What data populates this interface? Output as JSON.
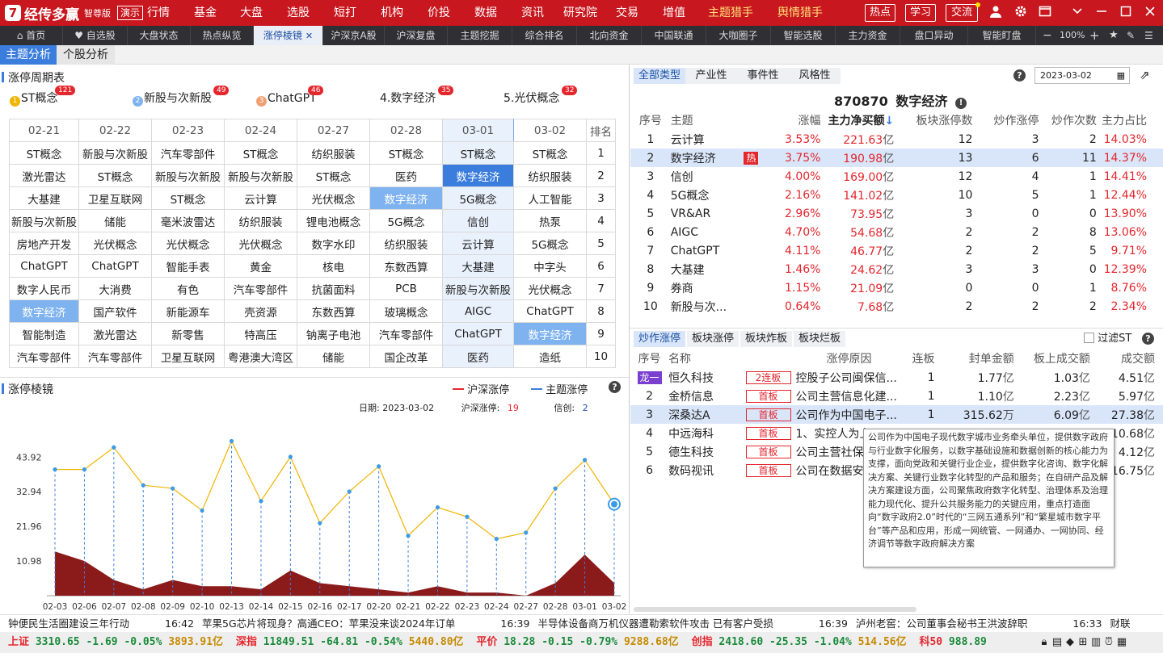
{
  "app": {
    "logo_letter": "7",
    "name": "经传多赢",
    "edition": "智尊版",
    "demo": "演示",
    "nav": [
      "行情",
      "基金",
      "大盘",
      "选股",
      "短打",
      "机构",
      "价投",
      "数据",
      "资讯",
      "研究院",
      "交易",
      "增值",
      "主题猎手",
      "舆情猎手"
    ],
    "boxes": [
      "热点",
      "学习",
      "交流"
    ]
  },
  "tabs": [
    "首页",
    "自选股",
    "大盘状态",
    "热点纵览",
    "涨停棱镜",
    "沪深京A股",
    "沪深复盘",
    "主题挖掘",
    "综合排名",
    "北向资金",
    "中国联通",
    "大咖圈子",
    "智能选股",
    "主力资金",
    "盘口异动",
    "智能盯盘"
  ],
  "active_tab": "涨停棱镜",
  "zoom": "100%",
  "subtabs": [
    "主题分析",
    "个股分析"
  ],
  "cycle": {
    "title": "涨停周期表",
    "legend": [
      {
        "rank": "1",
        "name": "ST概念",
        "count": "121",
        "color": "#f0b400"
      },
      {
        "rank": "2",
        "name": "新股与次新股",
        "count": "49",
        "color": "#7fb3f0"
      },
      {
        "rank": "3",
        "name": "ChatGPT",
        "count": "46",
        "color": "#f0a070"
      },
      {
        "rank": "4.",
        "name": "数字经济",
        "count": "35",
        "color": ""
      },
      {
        "rank": "5.",
        "name": "光伏概念",
        "count": "32",
        "color": ""
      }
    ],
    "dates": [
      "02-21",
      "02-22",
      "02-23",
      "02-24",
      "02-27",
      "02-28",
      "03-01",
      "03-02"
    ],
    "rank_header": "排名",
    "rows": [
      [
        "ST概念",
        "新股与次新股",
        "汽车零部件",
        "ST概念",
        "纺织服装",
        "ST概念",
        "ST概念",
        "ST概念",
        "1"
      ],
      [
        "激光雷达",
        "ST概念",
        "新股与次新股",
        "新股与次新股",
        "ST概念",
        "医药",
        "数字经济",
        "纺织服装",
        "2"
      ],
      [
        "大基建",
        "卫星互联网",
        "ST概念",
        "云计算",
        "光伏概念",
        "数字经济",
        "5G概念",
        "人工智能",
        "3"
      ],
      [
        "新股与次新股",
        "储能",
        "毫米波雷达",
        "纺织服装",
        "锂电池概念",
        "5G概念",
        "信创",
        "热泵",
        "4"
      ],
      [
        "房地产开发",
        "光伏概念",
        "光伏概念",
        "光伏概念",
        "数字水印",
        "纺织服装",
        "云计算",
        "5G概念",
        "5"
      ],
      [
        "ChatGPT",
        "ChatGPT",
        "智能手表",
        "黄金",
        "核电",
        "东数西算",
        "大基建",
        "中字头",
        "6"
      ],
      [
        "数字人民币",
        "大消费",
        "有色",
        "汽车零部件",
        "抗菌面料",
        "PCB",
        "新股与次新股",
        "光伏概念",
        "7"
      ],
      [
        "数字经济",
        "国产软件",
        "新能源车",
        "壳资源",
        "东数西算",
        "玻璃概念",
        "AIGC",
        "ChatGPT",
        "8"
      ],
      [
        "智能制造",
        "激光雷达",
        "新零售",
        "特高压",
        "钠离子电池",
        "汽车零部件",
        "ChatGPT",
        "数字经济",
        "9"
      ],
      [
        "汽车零部件",
        "汽车零部件",
        "卫星互联网",
        "粤港澳大湾区",
        "储能",
        "国企改革",
        "医药",
        "造纸",
        "10"
      ]
    ]
  },
  "prism": {
    "title": "涨停棱镜",
    "legend_a": "沪深涨停",
    "legend_b": "主题涨停",
    "info_date_label": "日期:",
    "info_date": "2023-03-02",
    "info_a_label": "沪深涨停:",
    "info_a": "19",
    "info_b_label": "信创:",
    "info_b": "2"
  },
  "chart_data": {
    "type": "line",
    "title": "",
    "x": [
      "03-02"
    ],
    "categories": [
      "02-03",
      "02-06",
      "02-07",
      "02-08",
      "02-09",
      "02-10",
      "02-13",
      "02-14",
      "02-15",
      "02-16",
      "02-17",
      "02-20",
      "02-21",
      "02-22",
      "02-23",
      "02-24",
      "02-27",
      "02-28",
      "03-01",
      "03-02"
    ],
    "yticks": [
      "43.92",
      "32.94",
      "21.96",
      "10.98"
    ],
    "ylim": [
      0,
      55
    ],
    "series": [
      {
        "name": "沪深涨停",
        "type": "area",
        "color": "#8b1a1a",
        "values": [
          14,
          11,
          5,
          2,
          5,
          3,
          3,
          2,
          8,
          4,
          3,
          2,
          1,
          3,
          1,
          1,
          0,
          4,
          13,
          4
        ]
      },
      {
        "name": "主题涨停",
        "type": "line",
        "color": "#f0b400",
        "values": [
          40,
          40,
          47,
          35,
          34,
          27,
          49,
          30,
          44,
          23,
          33,
          41,
          19,
          28,
          25,
          18,
          20,
          34,
          43,
          29
        ]
      }
    ]
  },
  "right_top": {
    "filters": [
      "全部类型",
      "产业性",
      "事件性",
      "风格性"
    ],
    "date": "2023-03-02",
    "code": "870870",
    "theme": "数字经济",
    "headers": [
      "序号",
      "主题",
      "",
      "涨幅",
      "主力净买额",
      "板块涨停数",
      "炒作涨停",
      "炒作次数",
      "主力占比"
    ],
    "rows": [
      [
        "1",
        "云计算",
        "",
        "3.53%",
        "221.63亿",
        "12",
        "3",
        "2",
        "14.03%"
      ],
      [
        "2",
        "数字经济",
        "热",
        "3.75%",
        "190.98亿",
        "13",
        "6",
        "11",
        "14.37%"
      ],
      [
        "3",
        "信创",
        "",
        "4.00%",
        "169.00亿",
        "12",
        "4",
        "1",
        "14.41%"
      ],
      [
        "4",
        "5G概念",
        "",
        "2.16%",
        "141.02亿",
        "10",
        "5",
        "1",
        "12.44%"
      ],
      [
        "5",
        "VR&AR",
        "",
        "2.96%",
        "73.95亿",
        "3",
        "0",
        "0",
        "13.90%"
      ],
      [
        "6",
        "AIGC",
        "",
        "4.70%",
        "54.68亿",
        "2",
        "2",
        "8",
        "13.06%"
      ],
      [
        "7",
        "ChatGPT",
        "",
        "4.11%",
        "46.77亿",
        "2",
        "2",
        "5",
        "9.71%"
      ],
      [
        "8",
        "大基建",
        "",
        "1.46%",
        "24.62亿",
        "3",
        "3",
        "0",
        "12.39%"
      ],
      [
        "9",
        "券商",
        "",
        "1.15%",
        "21.09亿",
        "0",
        "0",
        "1",
        "8.76%"
      ],
      [
        "10",
        "新股与次...",
        "",
        "0.64%",
        "7.68亿",
        "2",
        "2",
        "2",
        "2.34%"
      ]
    ]
  },
  "right_bottom": {
    "tabs": [
      "炒作涨停",
      "板块涨停",
      "板块炸板",
      "板块烂板"
    ],
    "filter_st": "过滤ST",
    "headers": [
      "序号",
      "名称",
      "涨停原因",
      "连板",
      "封单金额",
      "板上成交额",
      "成交额"
    ],
    "rows": [
      {
        "seq": "龙一",
        "name": "恒久科技",
        "tag": "2连板",
        "reason": "控股子公司闽保信...",
        "lb": "1",
        "fd": "1.77亿",
        "bs": "1.03亿",
        "cj": "4.51亿"
      },
      {
        "seq": "2",
        "name": "金桥信息",
        "tag": "首板",
        "reason": "公司主营信息化建...",
        "lb": "1",
        "fd": "1.10亿",
        "bs": "2.23亿",
        "cj": "5.97亿"
      },
      {
        "seq": "3",
        "name": "深桑达A",
        "tag": "首板",
        "reason": "公司作为中国电子...",
        "lb": "1",
        "fd": "315.62万",
        "bs": "6.09亿",
        "cj": "27.38亿"
      },
      {
        "seq": "4",
        "name": "中远海科",
        "tag": "首板",
        "reason": "1、实控人为上",
        "lb": "",
        "fd": "",
        "bs": "",
        "cj": "10.68亿"
      },
      {
        "seq": "5",
        "name": "德生科技",
        "tag": "首板",
        "reason": "公司主营社保",
        "lb": "",
        "fd": "",
        "bs": "",
        "cj": "4.12亿"
      },
      {
        "seq": "6",
        "name": "数码视讯",
        "tag": "首板",
        "reason": "公司在数据安全",
        "lb": "",
        "fd": "",
        "bs": "",
        "cj": "16.75亿"
      }
    ],
    "tooltip": "公司作为中国电子现代数字城市业务牵头单位，提供数字政府与行业数字化服务，以数字基础设施和数据创新的核心能力为支撑，面向党政和关键行业企业，提供数字化咨询、数字化解决方案、关键行业数字化转型的产品和服务；在自研产品及解决方案建设方面，公司聚焦政府数字化转型、治理体系及治理能力现代化、提升公共服务能力的关键应用，重点打造面向“数字政府2.0”时代的“三网五通系列”和“繁星城市数字平台”等产品和应用，形成一网统管、一网通办、一网协同、经济调节等数字政府解决方案"
  },
  "news": [
    {
      "time": "",
      "text": "钟便民生活圈建设三年行动"
    },
    {
      "time": "16:42",
      "text": "苹果5G芯片将现身？高通CEO：苹果没来谈2024年订单"
    },
    {
      "time": "16:39",
      "text": "半导体设备商万机仪器遭勒索软件攻击 已有客户受损"
    },
    {
      "time": "16:39",
      "text": "泸州老窖：公司董事会秘书王洪波辞职"
    },
    {
      "time": "16:33",
      "text": "财联"
    }
  ],
  "indices": [
    {
      "name": "上证",
      "price": "3310.65",
      "chg": "-1.69",
      "pct": "-0.05%",
      "amt": "3893.91亿"
    },
    {
      "name": "深指",
      "price": "11849.51",
      "chg": "-64.81",
      "pct": "-0.54%",
      "amt": "5440.80亿"
    },
    {
      "name": "平价",
      "price": "18.28",
      "chg": "-0.15",
      "pct": "-0.79%",
      "amt": "9288.68亿"
    },
    {
      "name": "创指",
      "price": "2418.60",
      "chg": "-25.35",
      "pct": "-1.04%",
      "amt": "514.56亿"
    },
    {
      "name": "科50",
      "price": "988.89",
      "chg": "",
      "pct": "",
      "amt": ""
    }
  ]
}
